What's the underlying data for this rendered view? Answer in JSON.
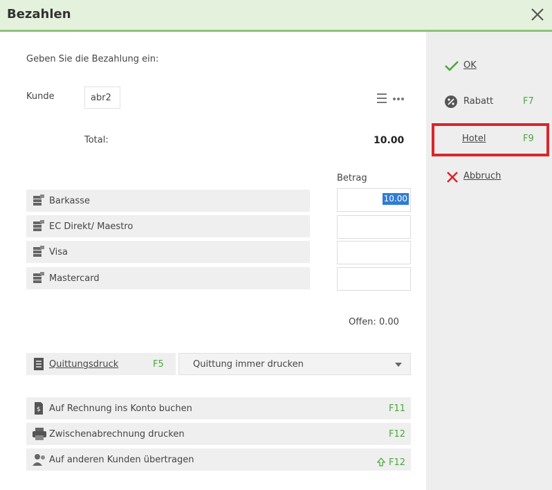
{
  "window": {
    "title": "Bezahlen"
  },
  "main": {
    "prompt": "Geben Sie die Bezahlung ein:",
    "customer_label": "Kunde",
    "customer_value": "abr2",
    "total_label": "Total:",
    "total_value": "10.00",
    "amount_header": "Betrag",
    "payment_methods": [
      {
        "label": "Barkasse",
        "amount": "10.00",
        "icon": "cash-icon"
      },
      {
        "label": "EC Direkt/ Maestro",
        "amount": "",
        "icon": "cash-icon"
      },
      {
        "label": "Visa",
        "amount": "",
        "icon": "cash-icon"
      },
      {
        "label": "Mastercard",
        "amount": "",
        "icon": "cash-icon"
      }
    ],
    "open_text": "Offen: 0.00",
    "receipt": {
      "label": "Quittungsdruck",
      "key": "F5",
      "selected": "Quittung immer drucken",
      "icon": "receipt-icon"
    },
    "actions": [
      {
        "label": "Auf Rechnung ins Konto buchen",
        "key": "F11",
        "icon": "invoice-icon"
      },
      {
        "label": "Zwischenabrechnung drucken",
        "key": "F12",
        "icon": "printer-icon"
      },
      {
        "label": "Auf anderen Kunden übertragen",
        "key": "F12",
        "icon": "transfer-user-icon",
        "modifier_icon": "shift-arrow-icon"
      }
    ]
  },
  "sidebar": {
    "ok": {
      "label": "OK",
      "icon": "check-icon"
    },
    "discount": {
      "label": "Rabatt",
      "key": "F7",
      "icon": "discount-icon"
    },
    "hotel": {
      "label": "Hotel",
      "key": "F9"
    },
    "cancel": {
      "label": "Abbruch",
      "icon": "x-icon"
    }
  },
  "colors": {
    "titlebar": "#e4f1dc",
    "titlebar_border": "#8dc27a",
    "shortcut": "#49a83b",
    "highlight": "#d9262c",
    "selection": "#2f7cd3"
  }
}
